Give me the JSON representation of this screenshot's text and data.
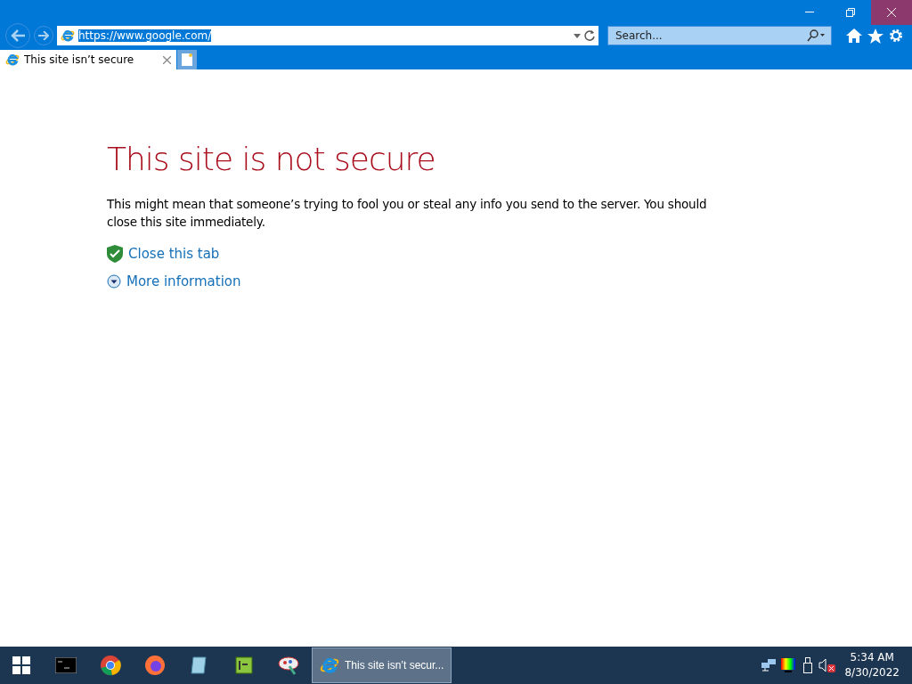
{
  "window_controls": [
    {
      "kind": "minimize",
      "hovered": false
    },
    {
      "kind": "restore",
      "hovered": false
    },
    {
      "kind": "close",
      "hovered": true
    }
  ],
  "address_bar": {
    "value": "https://www.google.com/",
    "selected": true
  },
  "search": {
    "placeholder": "Search..."
  },
  "tabs": [
    {
      "label": "This site isn’t secure",
      "selected": true
    }
  ],
  "page": {
    "heading": "This site is not secure",
    "message": "This might mean that someone’s trying to fool you or steal any info you send to the server. You should close this site immediately.",
    "links": [
      {
        "kind": "shield",
        "label": "Close this tab"
      },
      {
        "kind": "expand",
        "label": "More information"
      }
    ]
  },
  "taskbar": {
    "apps": [
      {
        "kind": "terminal",
        "selected": false
      },
      {
        "kind": "chrome",
        "selected": false
      },
      {
        "kind": "firefox",
        "selected": false
      },
      {
        "kind": "notepad",
        "selected": false
      },
      {
        "kind": "editor",
        "selected": false
      },
      {
        "kind": "paint",
        "selected": false
      },
      {
        "kind": "ie",
        "selected": true,
        "label": "This site isn’t secur..."
      }
    ],
    "tray": [
      {
        "kind": "network"
      },
      {
        "kind": "display"
      },
      {
        "kind": "usb"
      },
      {
        "kind": "volume-muted"
      }
    ],
    "time": "5:34 AM",
    "date": "8/30/2022"
  }
}
